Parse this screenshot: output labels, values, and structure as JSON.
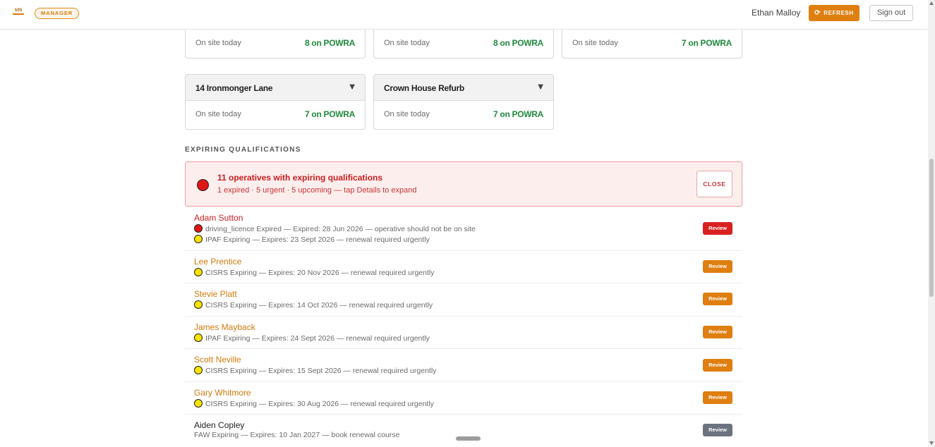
{
  "header": {
    "logo_text": "SOS",
    "role_badge": "MANAGER",
    "user_name": "Ethan Malloy",
    "refresh_label": "REFRESH",
    "refresh_icon": "⟳",
    "signout_label": "Sign out"
  },
  "colors": {
    "accent": "#de7f10",
    "powra_green": "#1f8a3c",
    "expired_red": "#e01515",
    "expiring_yellow": "#f7e300",
    "urgent_button": "#d92121",
    "warning_button": "#de7f10",
    "upcoming_button": "#6c737f"
  },
  "site_cards": [
    {
      "title": "",
      "on_site_label": "On site today",
      "powra": "8 on POWRA"
    },
    {
      "title": "",
      "on_site_label": "On site today",
      "powra": "8 on POWRA"
    },
    {
      "title": "",
      "on_site_label": "On site today",
      "powra": "7 on POWRA"
    },
    {
      "title": "14 Ironmonger Lane",
      "on_site_label": "On site today",
      "powra": "7 on POWRA",
      "caret": "▼"
    },
    {
      "title": "Crown House Refurb",
      "on_site_label": "On site today",
      "powra": "7 on POWRA",
      "caret": "▼"
    }
  ],
  "expiring": {
    "section_title": "EXPIRING QUALIFICATIONS",
    "alert_title": "11 operatives with expiring qualifications",
    "alert_subtitle": "1 expired · 5 urgent · 5 upcoming — tap Details to expand",
    "close_label": "CLOSE"
  },
  "operatives": [
    {
      "name": "Adam Sutton",
      "level": "expired",
      "review_label": "Review",
      "lines": [
        {
          "status": "red",
          "text": "driving_licence Expired — Expired: 28 Jun 2026 — operative should not be on site"
        },
        {
          "status": "yellow",
          "text": "IPAF Expiring — Expires: 23 Sept 2026 — renewal required urgently"
        }
      ]
    },
    {
      "name": "Lee Prentice",
      "level": "urgent",
      "review_label": "Review",
      "lines": [
        {
          "status": "yellow",
          "text": "CISRS Expiring — Expires: 20 Nov 2026 — renewal required urgently"
        }
      ]
    },
    {
      "name": "Stevie Platt",
      "level": "urgent",
      "review_label": "Review",
      "lines": [
        {
          "status": "yellow",
          "text": "CISRS Expiring — Expires: 14 Oct 2026 — renewal required urgently"
        }
      ]
    },
    {
      "name": "James Mayback",
      "level": "urgent",
      "review_label": "Review",
      "lines": [
        {
          "status": "yellow",
          "text": "IPAF Expiring — Expires: 24 Sept 2026 — renewal required urgently"
        }
      ]
    },
    {
      "name": "Scott Neville",
      "level": "urgent",
      "review_label": "Review",
      "lines": [
        {
          "status": "yellow",
          "text": "CISRS Expiring — Expires: 15 Sept 2026 — renewal required urgently"
        }
      ]
    },
    {
      "name": "Gary Whitmore",
      "level": "urgent",
      "review_label": "Review",
      "lines": [
        {
          "status": "yellow",
          "text": "CISRS Expiring — Expires: 30 Aug 2026 — renewal required urgently"
        }
      ]
    },
    {
      "name": "Aiden Copley",
      "level": "upcoming",
      "review_label": "Review",
      "lines": [
        {
          "status": "none",
          "text": "FAW Expiring — Expires: 10 Jan 2027 — book renewal course"
        }
      ]
    }
  ]
}
